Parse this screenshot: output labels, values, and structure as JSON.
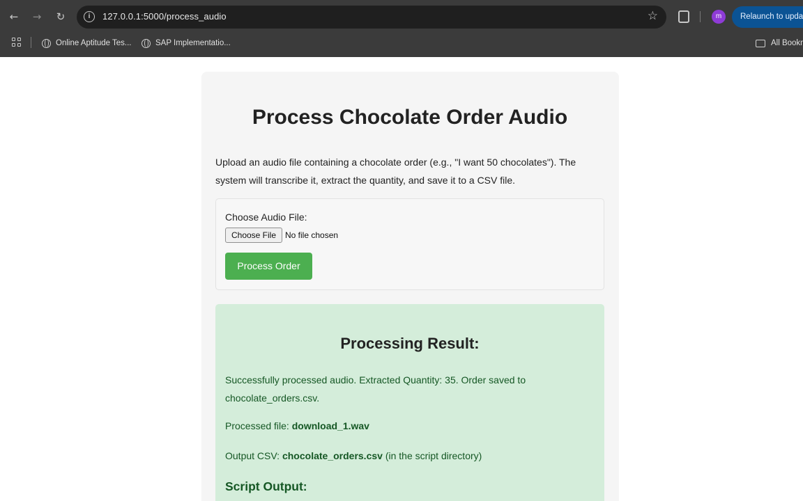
{
  "browser": {
    "url": "127.0.0.1:5000/process_audio",
    "relaunch_label": "Relaunch to update",
    "avatar_initial": "m",
    "bookmarks": [
      {
        "label": "Online Aptitude Tes..."
      },
      {
        "label": "SAP Implementatio..."
      }
    ],
    "all_bookmarks_label": "All Bookmarks"
  },
  "page": {
    "title": "Process Chocolate Order Audio",
    "intro": "Upload an audio file containing a chocolate order (e.g., \"I want 50 chocolates\"). The system will transcribe it, extract the quantity, and save it to a CSV file.",
    "upload": {
      "label": "Choose Audio File:",
      "choose_button": "Choose File",
      "file_status": "No file chosen",
      "submit_label": "Process Order"
    },
    "result": {
      "title": "Processing Result:",
      "message": "Successfully processed audio. Extracted Quantity: 35. Order saved to chocolate_orders.csv.",
      "processed_label": "Processed file:",
      "processed_value": "download_1.wav",
      "csv_label": "Output CSV:",
      "csv_value": "chocolate_orders.csv",
      "csv_note": "(in the script directory)",
      "script_output_title": "Script Output:"
    }
  },
  "colors": {
    "accent_green": "#4caf50",
    "result_bg": "#d4edda",
    "result_text": "#155724"
  }
}
